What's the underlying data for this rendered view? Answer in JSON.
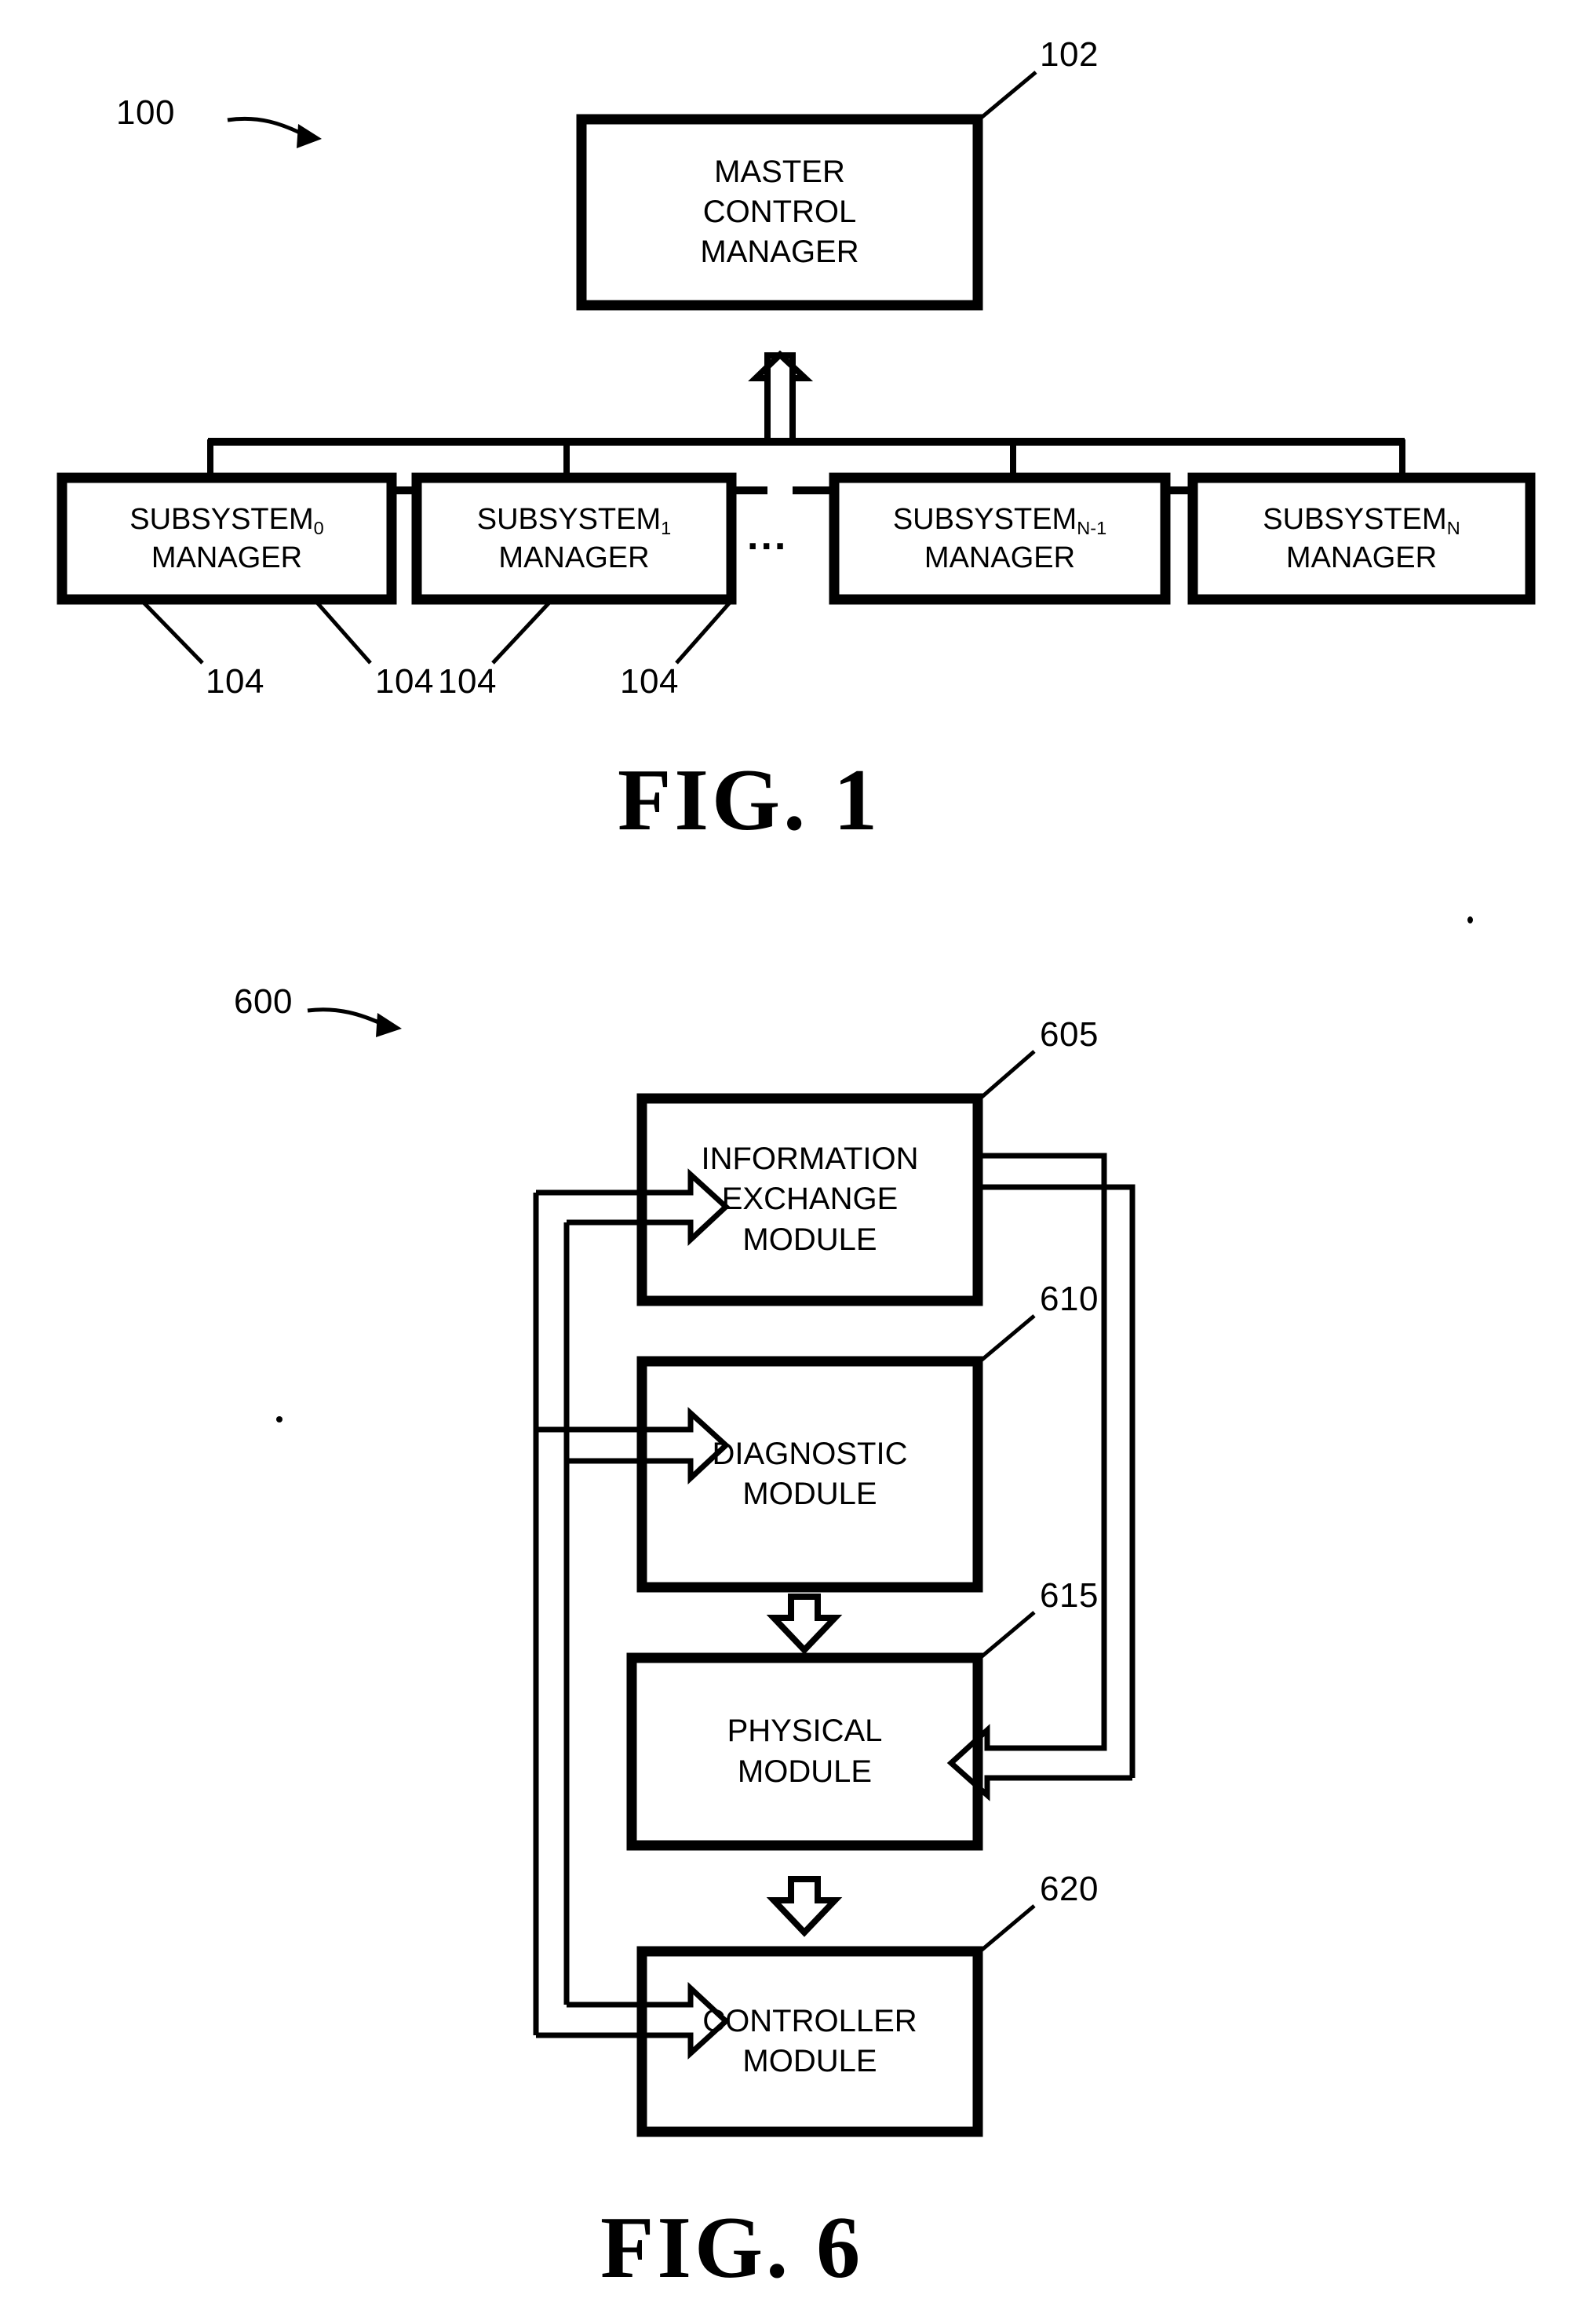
{
  "document": {
    "kind": "patent-drawing-sheet",
    "background_color": "#ffffff",
    "ink_color": "#000000"
  },
  "figures": [
    {
      "id": "fig1",
      "caption": "FIG. 1",
      "system_ref": "100",
      "nodes": [
        {
          "ref": "102",
          "name": "master-control-manager",
          "lines": [
            "MASTER",
            "CONTROL",
            "MANAGER"
          ]
        },
        {
          "ref": "104",
          "name": "subsystem-0-manager",
          "lines": [
            "SUBSYSTEM",
            "MANAGER"
          ],
          "subscript": "0"
        },
        {
          "ref": "104",
          "name": "subsystem-1-manager",
          "lines": [
            "SUBSYSTEM",
            "MANAGER"
          ],
          "subscript": "1"
        },
        {
          "ref": "104",
          "name": "subsystem-n-minus-1-manager",
          "lines": [
            "SUBSYSTEM",
            "MANAGER"
          ],
          "subscript": "N-1"
        },
        {
          "ref": "104",
          "name": "subsystem-n-manager",
          "lines": [
            "SUBSYSTEM",
            "MANAGER"
          ],
          "subscript": "N"
        }
      ],
      "ellipsis": "..."
    },
    {
      "id": "fig6",
      "caption": "FIG. 6",
      "system_ref": "600",
      "nodes": [
        {
          "ref": "605",
          "name": "information-exchange-module",
          "lines": [
            "INFORMATION",
            "EXCHANGE",
            "MODULE"
          ]
        },
        {
          "ref": "610",
          "name": "diagnostic-module",
          "lines": [
            "DIAGNOSTIC",
            "MODULE"
          ]
        },
        {
          "ref": "615",
          "name": "physical-module",
          "lines": [
            "PHYSICAL",
            "MODULE"
          ]
        },
        {
          "ref": "620",
          "name": "controller-module",
          "lines": [
            "CONTROLLER",
            "MODULE"
          ]
        }
      ]
    }
  ],
  "fig1": {
    "system_ref": "100",
    "caption": "FIG. 1",
    "ellipsis": "...",
    "master": {
      "ref": "102",
      "line1": "MASTER",
      "line2": "CONTROL",
      "line3": "MANAGER"
    },
    "sub0": {
      "ref": "104",
      "name": "SUBSYSTEM",
      "sub": "0",
      "line2": "MANAGER"
    },
    "sub1": {
      "ref": "104",
      "name": "SUBSYSTEM",
      "sub": "1",
      "line2": "MANAGER"
    },
    "subn1": {
      "ref": "104",
      "name": "SUBSYSTEM",
      "sub": "N-1",
      "line2": "MANAGER"
    },
    "subn": {
      "ref": "104",
      "name": "SUBSYSTEM",
      "sub": "N",
      "line2": "MANAGER"
    }
  },
  "fig6": {
    "system_ref": "600",
    "caption": "FIG. 6",
    "info": {
      "ref": "605",
      "line1": "INFORMATION",
      "line2": "EXCHANGE",
      "line3": "MODULE"
    },
    "diag": {
      "ref": "610",
      "line1": "DIAGNOSTIC",
      "line2": "MODULE"
    },
    "phys": {
      "ref": "615",
      "line1": "PHYSICAL",
      "line2": "MODULE"
    },
    "ctrl": {
      "ref": "620",
      "line1": "CONTROLLER",
      "line2": "MODULE"
    }
  }
}
